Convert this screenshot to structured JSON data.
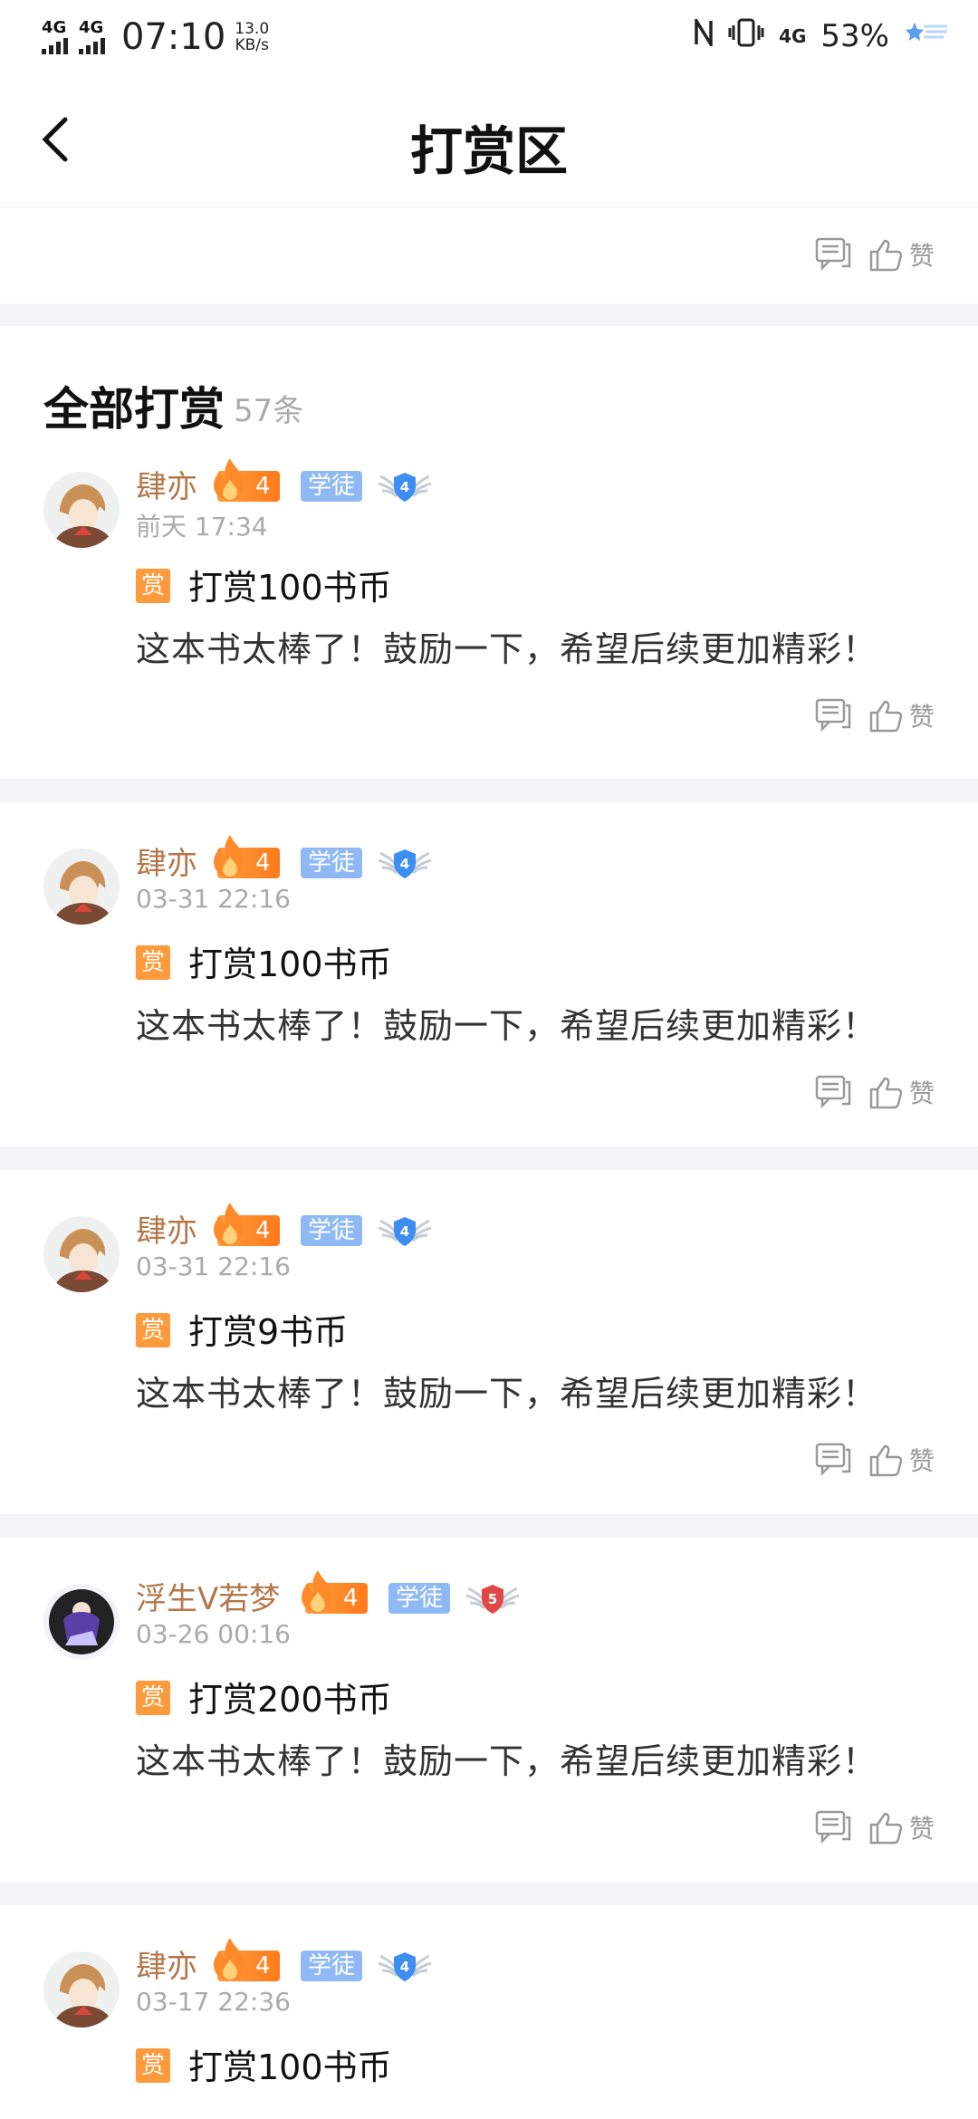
{
  "status": {
    "net1": "4G",
    "net2": "4G",
    "time": "07:10",
    "speed_value": "13.0",
    "speed_unit": "KB/s",
    "net3": "4G",
    "battery": "53%"
  },
  "header": {
    "title": "打赏区"
  },
  "top_like_label": "赞",
  "section": {
    "title": "全部打赏",
    "count": "57条"
  },
  "entries": [
    {
      "name": "肆亦",
      "level": "4",
      "tag": "学徒",
      "wing": "4",
      "time": "前天 17:34",
      "badge": "赏",
      "reward": "打赏100书币",
      "message": "这本书太棒了！鼓励一下，希望后续更加精彩！",
      "like_label": "赞"
    },
    {
      "name": "肆亦",
      "level": "4",
      "tag": "学徒",
      "wing": "4",
      "time": "03-31 22:16",
      "badge": "赏",
      "reward": "打赏100书币",
      "message": "这本书太棒了！鼓励一下，希望后续更加精彩！",
      "like_label": "赞"
    },
    {
      "name": "肆亦",
      "level": "4",
      "tag": "学徒",
      "wing": "4",
      "time": "03-31 22:16",
      "badge": "赏",
      "reward": "打赏9书币",
      "message": "这本书太棒了！鼓励一下，希望后续更加精彩！",
      "like_label": "赞"
    },
    {
      "name": "浮生V若梦",
      "level": "4",
      "tag": "学徒",
      "wing": "5",
      "time": "03-26 00:16",
      "badge": "赏",
      "reward": "打赏200书币",
      "message": "这本书太棒了！鼓励一下，希望后续更加精彩！",
      "like_label": "赞"
    },
    {
      "name": "肆亦",
      "level": "4",
      "tag": "学徒",
      "wing": "4",
      "time": "03-17 22:36",
      "badge": "赏",
      "reward": "打赏100书币",
      "message": "",
      "like_label": ""
    }
  ],
  "colors": {
    "accent": "#ff9a3c",
    "username": "#b3774a",
    "tag_blue": "#8fb9f5",
    "wing_blue": "#3d8ef0",
    "wing_red": "#e04848"
  }
}
